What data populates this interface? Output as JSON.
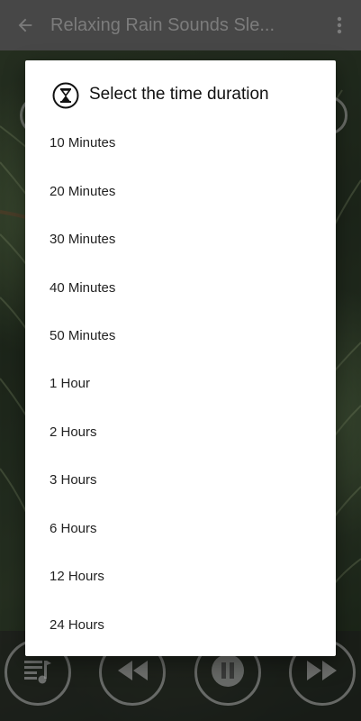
{
  "app_bar": {
    "title": "Relaxing Rain Sounds Sle...",
    "back_icon": "arrow-left-icon",
    "more_icon": "more-vert-icon",
    "background": "#6d6d6d"
  },
  "dialog": {
    "icon": "hourglass-icon",
    "title": "Select the time duration",
    "options": [
      {
        "label": "10 Minutes"
      },
      {
        "label": "20 Minutes"
      },
      {
        "label": "30 Minutes"
      },
      {
        "label": "40 Minutes"
      },
      {
        "label": "50 Minutes"
      },
      {
        "label": "1 Hour"
      },
      {
        "label": "2 Hours"
      },
      {
        "label": "3 Hours"
      },
      {
        "label": "6 Hours"
      },
      {
        "label": "12 Hours"
      },
      {
        "label": "24 Hours"
      }
    ]
  },
  "player_controls": {
    "buttons": [
      {
        "icon": "playlist-music-icon"
      },
      {
        "icon": "rewind-icon"
      },
      {
        "icon": "pause-icon"
      },
      {
        "icon": "fast-forward-icon"
      }
    ]
  }
}
